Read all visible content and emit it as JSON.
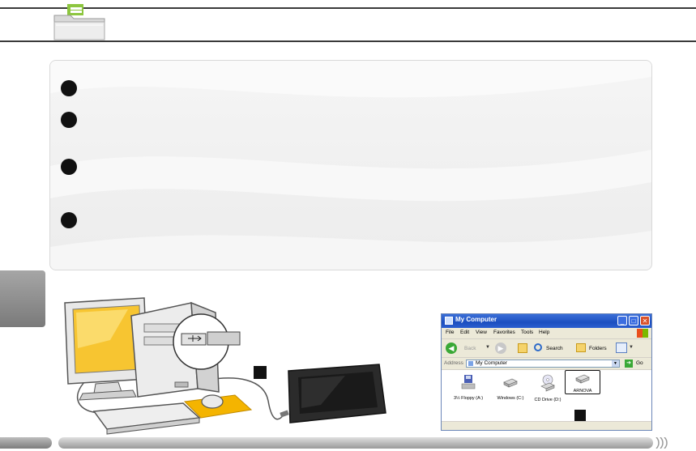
{
  "explorer": {
    "title": "My Computer",
    "menu": [
      "File",
      "Edit",
      "View",
      "Favorites",
      "Tools",
      "Help"
    ],
    "toolbar": {
      "back_label": "Back",
      "search_label": "Search",
      "folders_label": "Folders"
    },
    "address": {
      "label": "Address",
      "value": "My Computer",
      "go_label": "Go"
    },
    "drives": [
      {
        "label": "3½ Floppy (A:)",
        "icon": "floppy-drive-icon"
      },
      {
        "label": "Windows (C:)",
        "icon": "hard-drive-icon"
      },
      {
        "label": "CD Drive (D:)",
        "icon": "cd-drive-icon"
      },
      {
        "label": "ARNOVA",
        "icon": "removable-drive-icon",
        "selected": true
      }
    ]
  },
  "colors": {
    "header_line": "#3a3a3a",
    "folder_accent": "#8dc63f",
    "panel_bg": "#f2f2f2",
    "xp_titlebar": "#2b5fd0",
    "monitor_screen": "#f7c531",
    "mousepad": "#f4b400"
  }
}
